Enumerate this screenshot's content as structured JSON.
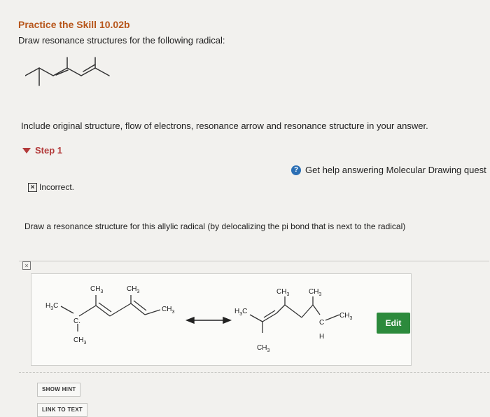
{
  "header": {
    "title": "Practice the Skill 10.02b",
    "subtitle": "Draw resonance structures for the following radical:"
  },
  "instructions": "Include original structure, flow of electrons, resonance arrow and resonance structure in your answer.",
  "step": {
    "label": "Step 1"
  },
  "help": {
    "icon": "?",
    "text": "Get help answering Molecular Drawing quest"
  },
  "feedback": {
    "icon": "×",
    "text": "Incorrect."
  },
  "prompt": "Draw a resonance structure for this allylic radical (by delocalizing the pi bond that is next to the radical)",
  "workspace": {
    "close_icon": "×",
    "edit_label": "Edit",
    "labels": {
      "ch3": "CH",
      "h3c": "H",
      "sub3": "3",
      "c": "C",
      "c_dot": "C.",
      "h": "H"
    }
  },
  "buttons": {
    "show_hint": "SHOW HINT",
    "link_to_text": "LINK TO TEXT"
  },
  "colors": {
    "title": "#b7561b",
    "step": "#b33a3a",
    "edit": "#2c8a3c",
    "help": "#2b6fb4"
  }
}
